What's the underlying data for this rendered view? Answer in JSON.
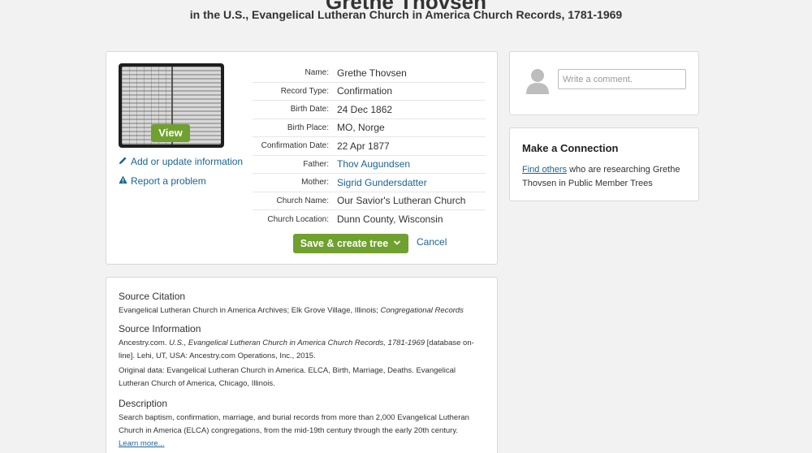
{
  "header": {
    "title": "Grethe Thovsen",
    "subtitle": "in the U.S., Evangelical Lutheran Church in America Church Records, 1781-1969"
  },
  "record": {
    "view_label": "View",
    "add_update_label": "Add or update information",
    "report_problem_label": "Report a problem",
    "facts": [
      {
        "label": "Name:",
        "value": "Grethe Thovsen",
        "link": false
      },
      {
        "label": "Record Type:",
        "value": "Confirmation",
        "link": false
      },
      {
        "label": "Birth Date:",
        "value": "24 Dec 1862",
        "link": false
      },
      {
        "label": "Birth Place:",
        "value": "MO, Norge",
        "link": false
      },
      {
        "label": "Confirmation Date:",
        "value": "22 Apr 1877",
        "link": false
      },
      {
        "label": "Father:",
        "value": "Thov Augundsen",
        "link": true
      },
      {
        "label": "Mother:",
        "value": "Sigrid Gundersdatter",
        "link": true
      },
      {
        "label": "Church Name:",
        "value": "Our Savior's Lutheran Church",
        "link": false
      },
      {
        "label": "Church Location:",
        "value": "Dunn County, Wisconsin",
        "link": false
      }
    ],
    "save_label": "Save & create tree",
    "cancel_label": "Cancel"
  },
  "source": {
    "citation_heading": "Source Citation",
    "citation_text": "Evangelical Lutheran Church in America Archives; Elk Grove Village, Illinois;",
    "citation_italic": "Congregational Records",
    "info_heading": "Source Information",
    "info_prefix": "Ancestry.com.",
    "info_italic": "U.S., Evangelical Lutheran Church in America Church Records, 1781-1969",
    "info_suffix": "[database on-line]. Lehi, UT, USA: Ancestry.com Operations, Inc., 2015.",
    "original_data": "Original data: Evangelical Lutheran Church in America. ELCA, Birth, Marriage, Deaths. Evangelical Lutheran Church of America, Chicago, Illinois.",
    "description_heading": "Description",
    "description_text": "Search baptism, confirmation, marriage, and burial records from more than 2,000 Evangelical Lutheran Church in America (ELCA) congregations, from the mid-19th century through the early 20th century.",
    "learn_more": "Learn more..."
  },
  "comment": {
    "placeholder": "Write a comment."
  },
  "connection": {
    "title": "Make a Connection",
    "link_text": "Find others",
    "text": "who are researching Grethe Thovsen in Public Member Trees"
  },
  "colors": {
    "accent_green": "#6fa030",
    "link_blue": "#1a6496",
    "background": "#f2f2f2"
  }
}
